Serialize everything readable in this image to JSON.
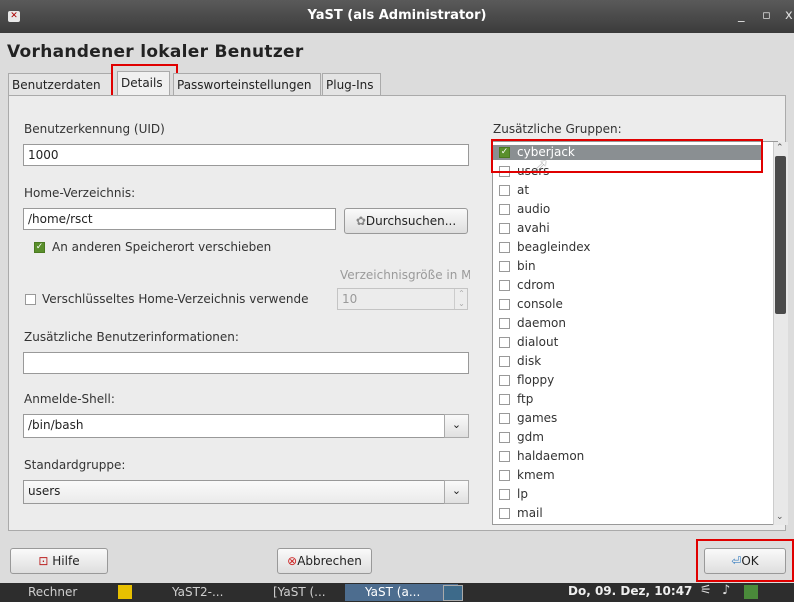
{
  "window": {
    "title": "YaST (als Administrator)",
    "close_glyph": "✕",
    "minimize_glyph": "_",
    "maximize_glyph": "▫",
    "extra_glyph": "x"
  },
  "page_title": "Vorhandener lokaler Benutzer",
  "tabs": [
    {
      "label": "Benutzerdaten",
      "active": false
    },
    {
      "label": "Details",
      "active": true
    },
    {
      "label": "Passworteinstellungen",
      "active": false
    },
    {
      "label": "Plug-Ins",
      "active": false
    }
  ],
  "uid": {
    "label": "Benutzerkennung (UID)",
    "value": "1000"
  },
  "home": {
    "label": "Home-Verzeichnis:",
    "value": "/home/rsct",
    "browse_label": "Durchsuchen..."
  },
  "move_home": {
    "label": "An anderen Speicherort verschieben",
    "checked": true
  },
  "dir_size": {
    "label": "Verzeichnisgröße in M",
    "value": "10"
  },
  "encrypted_home": {
    "label": "Verschlüsseltes Home-Verzeichnis verwende",
    "checked": false
  },
  "extra_info": {
    "label": "Zusätzliche Benutzerinformationen:",
    "value": ""
  },
  "shell": {
    "label": "Anmelde-Shell:",
    "value": "/bin/bash"
  },
  "default_group": {
    "label": "Standardgruppe:",
    "value": "users"
  },
  "groups": {
    "label": "Zusätzliche Gruppen:",
    "items": [
      {
        "name": "cyberjack",
        "checked": true,
        "selected": true
      },
      {
        "name": "users",
        "checked": false
      },
      {
        "name": "at",
        "checked": false
      },
      {
        "name": "audio",
        "checked": false
      },
      {
        "name": "avahi",
        "checked": false
      },
      {
        "name": "beagleindex",
        "checked": false
      },
      {
        "name": "bin",
        "checked": false
      },
      {
        "name": "cdrom",
        "checked": false
      },
      {
        "name": "console",
        "checked": false
      },
      {
        "name": "daemon",
        "checked": false
      },
      {
        "name": "dialout",
        "checked": false
      },
      {
        "name": "disk",
        "checked": false
      },
      {
        "name": "floppy",
        "checked": false
      },
      {
        "name": "ftp",
        "checked": false
      },
      {
        "name": "games",
        "checked": false
      },
      {
        "name": "gdm",
        "checked": false
      },
      {
        "name": "haldaemon",
        "checked": false
      },
      {
        "name": "kmem",
        "checked": false
      },
      {
        "name": "lp",
        "checked": false
      },
      {
        "name": "mail",
        "checked": false
      }
    ]
  },
  "buttons": {
    "help": "Hilfe",
    "cancel": "Abbrechen",
    "ok": "OK"
  },
  "taskbar": {
    "items": [
      "Rechner",
      "YaST2-...",
      "[YaST (...",
      "YaST (a..."
    ],
    "clock": "Do, 09. Dez, 10:47"
  },
  "colors": {
    "highlight": "#e00000",
    "checkbox_checked": "#5a8f2c",
    "selection": "#8a8f92"
  }
}
